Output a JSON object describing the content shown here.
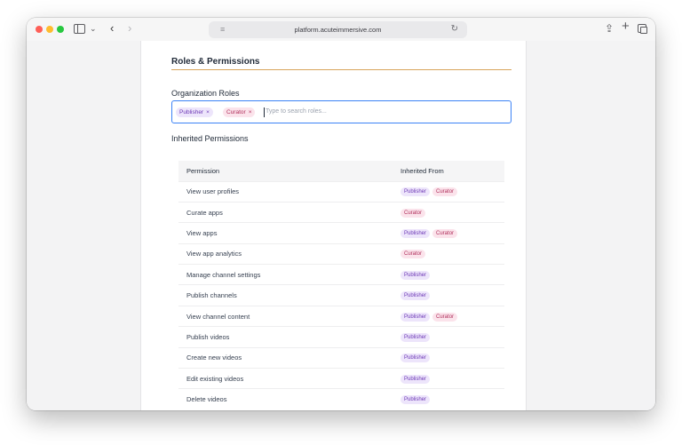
{
  "browser": {
    "url": "platform.acuteimmersive.com"
  },
  "page": {
    "section_title": "Roles & Permissions",
    "roles_label": "Organization Roles",
    "selected_roles": [
      {
        "label": "Publisher",
        "remove": "×"
      },
      {
        "label": "Curator",
        "remove": "×"
      }
    ],
    "search_placeholder": "Type to search roles...",
    "inherited_label": "Inherited Permissions"
  },
  "colors": {
    "accent_rule": "#d8a45c",
    "input_focus": "#3b82f6",
    "publisher_bg": "#ede5fb",
    "publisher_text": "#6d38b5",
    "curator_bg": "#fbe3eb",
    "curator_text": "#b0305c"
  },
  "table": {
    "headers": [
      "Permission",
      "Inherited From"
    ],
    "rows": [
      {
        "permission": "View user profiles",
        "from": [
          "Publisher",
          "Curator"
        ]
      },
      {
        "permission": "Curate apps",
        "from": [
          "Curator"
        ]
      },
      {
        "permission": "View apps",
        "from": [
          "Publisher",
          "Curator"
        ]
      },
      {
        "permission": "View app analytics",
        "from": [
          "Curator"
        ]
      },
      {
        "permission": "Manage channel settings",
        "from": [
          "Publisher"
        ]
      },
      {
        "permission": "Publish channels",
        "from": [
          "Publisher"
        ]
      },
      {
        "permission": "View channel content",
        "from": [
          "Publisher",
          "Curator"
        ]
      },
      {
        "permission": "Publish videos",
        "from": [
          "Publisher"
        ]
      },
      {
        "permission": "Create new videos",
        "from": [
          "Publisher"
        ]
      },
      {
        "permission": "Edit existing videos",
        "from": [
          "Publisher"
        ]
      },
      {
        "permission": "Delete videos",
        "from": [
          "Publisher"
        ]
      }
    ]
  },
  "icons": {
    "sidebar_toggle": "sidebar-icon",
    "back": "chevron-left-icon",
    "forward": "chevron-right-icon",
    "reload": "reload-icon",
    "share": "share-icon",
    "new_tab": "plus-icon",
    "tabs": "tab-overview-icon"
  }
}
